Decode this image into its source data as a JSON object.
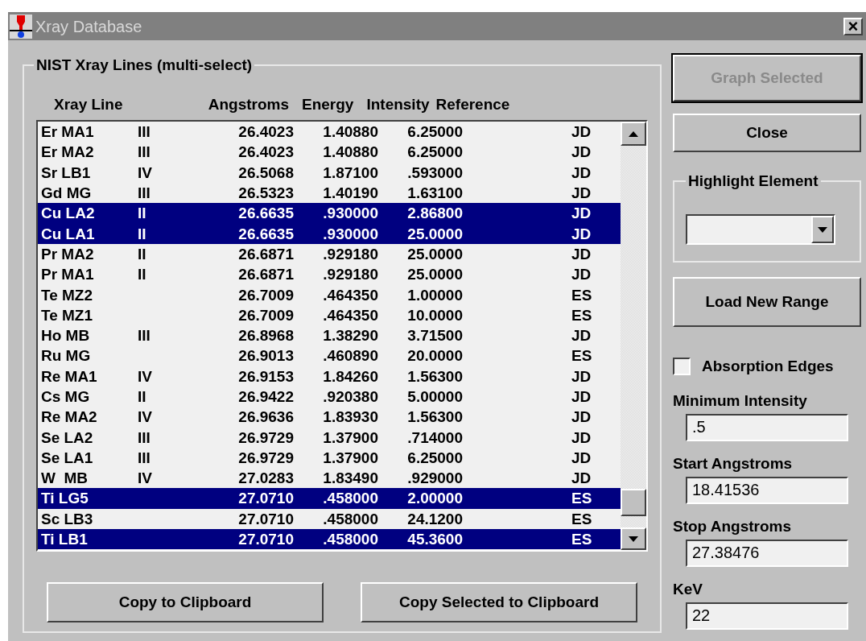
{
  "window": {
    "title": "Xray Database",
    "close": "×"
  },
  "lines_group": {
    "title": "NIST Xray Lines (multi-select)",
    "columns": [
      "Xray Line",
      "Angstroms",
      "Energy",
      "Intensity",
      "Reference"
    ],
    "rows": [
      {
        "line": "Er MA1",
        "level": "III",
        "angstroms": "26.4023",
        "energy": "1.40880",
        "intensity": "6.25000",
        "reference": "JD",
        "selected": false
      },
      {
        "line": "Er MA2",
        "level": "III",
        "angstroms": "26.4023",
        "energy": "1.40880",
        "intensity": "6.25000",
        "reference": "JD",
        "selected": false
      },
      {
        "line": "Sr LB1",
        "level": "IV",
        "angstroms": "26.5068",
        "energy": "1.87100",
        "intensity": ".593000",
        "reference": "JD",
        "selected": false
      },
      {
        "line": "Gd MG",
        "level": "III",
        "angstroms": "26.5323",
        "energy": "1.40190",
        "intensity": "1.63100",
        "reference": "JD",
        "selected": false
      },
      {
        "line": "Cu LA2",
        "level": "II",
        "angstroms": "26.6635",
        "energy": ".930000",
        "intensity": "2.86800",
        "reference": "JD",
        "selected": true
      },
      {
        "line": "Cu LA1",
        "level": "II",
        "angstroms": "26.6635",
        "energy": ".930000",
        "intensity": "25.0000",
        "reference": "JD",
        "selected": true
      },
      {
        "line": "Pr MA2",
        "level": "II",
        "angstroms": "26.6871",
        "energy": ".929180",
        "intensity": "25.0000",
        "reference": "JD",
        "selected": false
      },
      {
        "line": "Pr MA1",
        "level": "II",
        "angstroms": "26.6871",
        "energy": ".929180",
        "intensity": "25.0000",
        "reference": "JD",
        "selected": false
      },
      {
        "line": "Te MZ2",
        "angstroms": "26.7009",
        "energy": ".464350",
        "intensity": "1.00000",
        "reference": "ES",
        "selected": false
      },
      {
        "line": "Te MZ1",
        "angstroms": "26.7009",
        "energy": ".464350",
        "intensity": "10.0000",
        "reference": "ES",
        "selected": false
      },
      {
        "line": "Ho MB",
        "level": "III",
        "angstroms": "26.8968",
        "energy": "1.38290",
        "intensity": "3.71500",
        "reference": "JD",
        "selected": false
      },
      {
        "line": "Ru MG",
        "angstroms": "26.9013",
        "energy": ".460890",
        "intensity": "20.0000",
        "reference": "ES",
        "selected": false
      },
      {
        "line": "Re MA1",
        "level": "IV",
        "angstroms": "26.9153",
        "energy": "1.84260",
        "intensity": "1.56300",
        "reference": "JD",
        "selected": false
      },
      {
        "line": "Cs MG",
        "level": "II",
        "angstroms": "26.9422",
        "energy": ".920380",
        "intensity": "5.00000",
        "reference": "JD",
        "selected": false
      },
      {
        "line": "Re MA2",
        "level": "IV",
        "angstroms": "26.9636",
        "energy": "1.83930",
        "intensity": "1.56300",
        "reference": "JD",
        "selected": false
      },
      {
        "line": "Se LA2",
        "level": "III",
        "angstroms": "26.9729",
        "energy": "1.37900",
        "intensity": ".714000",
        "reference": "JD",
        "selected": false
      },
      {
        "line": "Se LA1",
        "level": "III",
        "angstroms": "26.9729",
        "energy": "1.37900",
        "intensity": "6.25000",
        "reference": "JD",
        "selected": false
      },
      {
        "line": "W  MB",
        "level": "IV",
        "angstroms": "27.0283",
        "energy": "1.83490",
        "intensity": ".929000",
        "reference": "JD",
        "selected": false
      },
      {
        "line": "Ti LG5",
        "angstroms": "27.0710",
        "energy": ".458000",
        "intensity": "2.00000",
        "reference": "ES",
        "selected": true
      },
      {
        "line": "Sc LB3",
        "angstroms": "27.0710",
        "energy": ".458000",
        "intensity": "24.1200",
        "reference": "ES",
        "selected": false
      },
      {
        "line": "Ti LB1",
        "angstroms": "27.0710",
        "energy": ".458000",
        "intensity": "45.3600",
        "reference": "ES",
        "selected": true
      }
    ],
    "buttons": [
      "Copy to Clipboard",
      "Copy Selected to Clipboard"
    ]
  },
  "side": [
    {
      "kind": "button",
      "label": "Graph Selected",
      "disabled": true
    },
    {
      "kind": "button",
      "label": "Close",
      "disabled": false
    },
    {
      "kind": "dropdown",
      "label": "Highlight Element"
    },
    {
      "kind": "button",
      "label": "Load New Range",
      "disabled": false
    },
    {
      "kind": "checkbox",
      "label": "Absorption Edges",
      "checked": false
    },
    {
      "kind": "field",
      "label": "Minimum Intensity",
      "value": ".5"
    },
    {
      "kind": "field",
      "label": "Start Angstroms",
      "value": "18.41536"
    },
    {
      "kind": "field",
      "label": "Stop Angstroms",
      "value": "27.38476"
    },
    {
      "kind": "field",
      "label": "KeV",
      "value": "22"
    }
  ]
}
